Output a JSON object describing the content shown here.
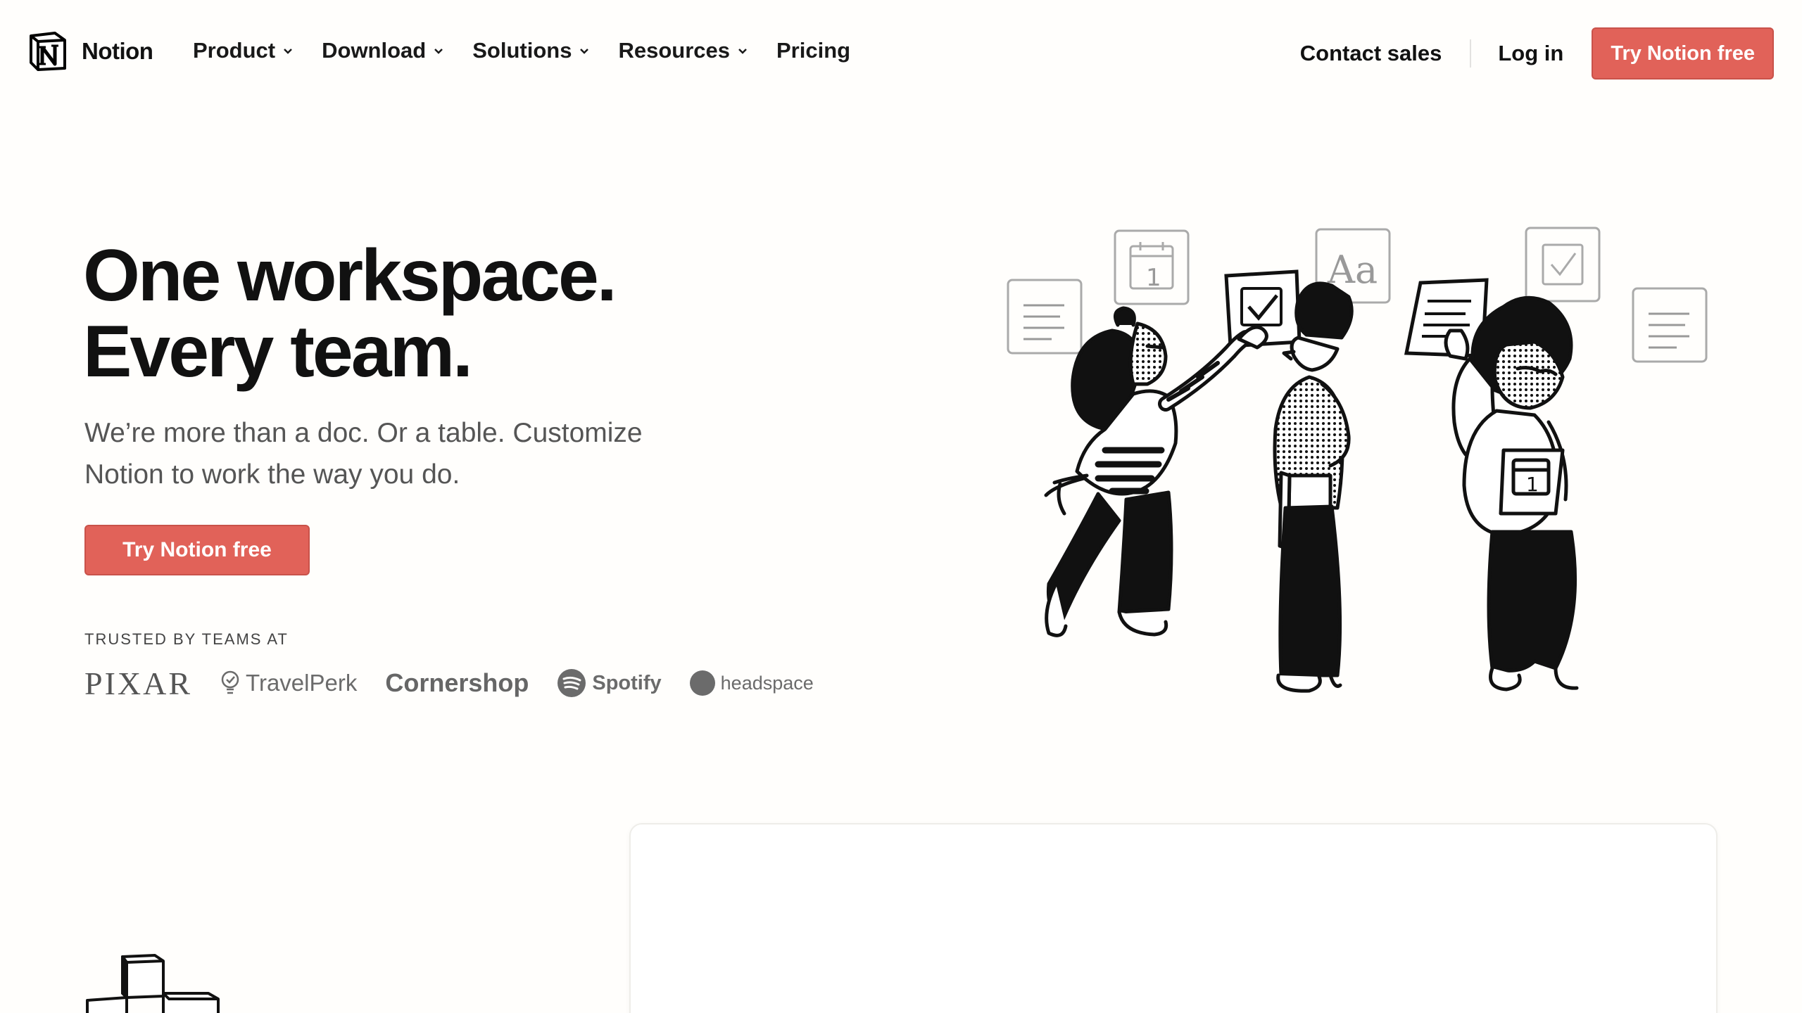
{
  "nav": {
    "brand": "Notion",
    "links": [
      {
        "label": "Product",
        "dropdown": true
      },
      {
        "label": "Download",
        "dropdown": true
      },
      {
        "label": "Solutions",
        "dropdown": true
      },
      {
        "label": "Resources",
        "dropdown": true
      },
      {
        "label": "Pricing",
        "dropdown": false
      }
    ],
    "contact_sales": "Contact sales",
    "log_in": "Log in",
    "cta": "Try Notion free"
  },
  "hero": {
    "title_line1": "One workspace.",
    "title_line2": "Every team.",
    "subtitle": "We’re more than a doc. Or a table. Customize Notion to work the way you do.",
    "cta": "Try Notion free",
    "trusted_label": "TRUSTED BY TEAMS AT",
    "logos": [
      "PIXAR",
      "TravelPerk",
      "Cornershop",
      "Spotify",
      "headspace"
    ]
  },
  "colors": {
    "accent": "#e16259",
    "background": "#fffefc",
    "text": "#111111",
    "muted": "#555555"
  },
  "icons": {
    "brand": "notion-logo-icon",
    "dropdown": "chevron-down-icon",
    "illustration": "team-illustration"
  }
}
